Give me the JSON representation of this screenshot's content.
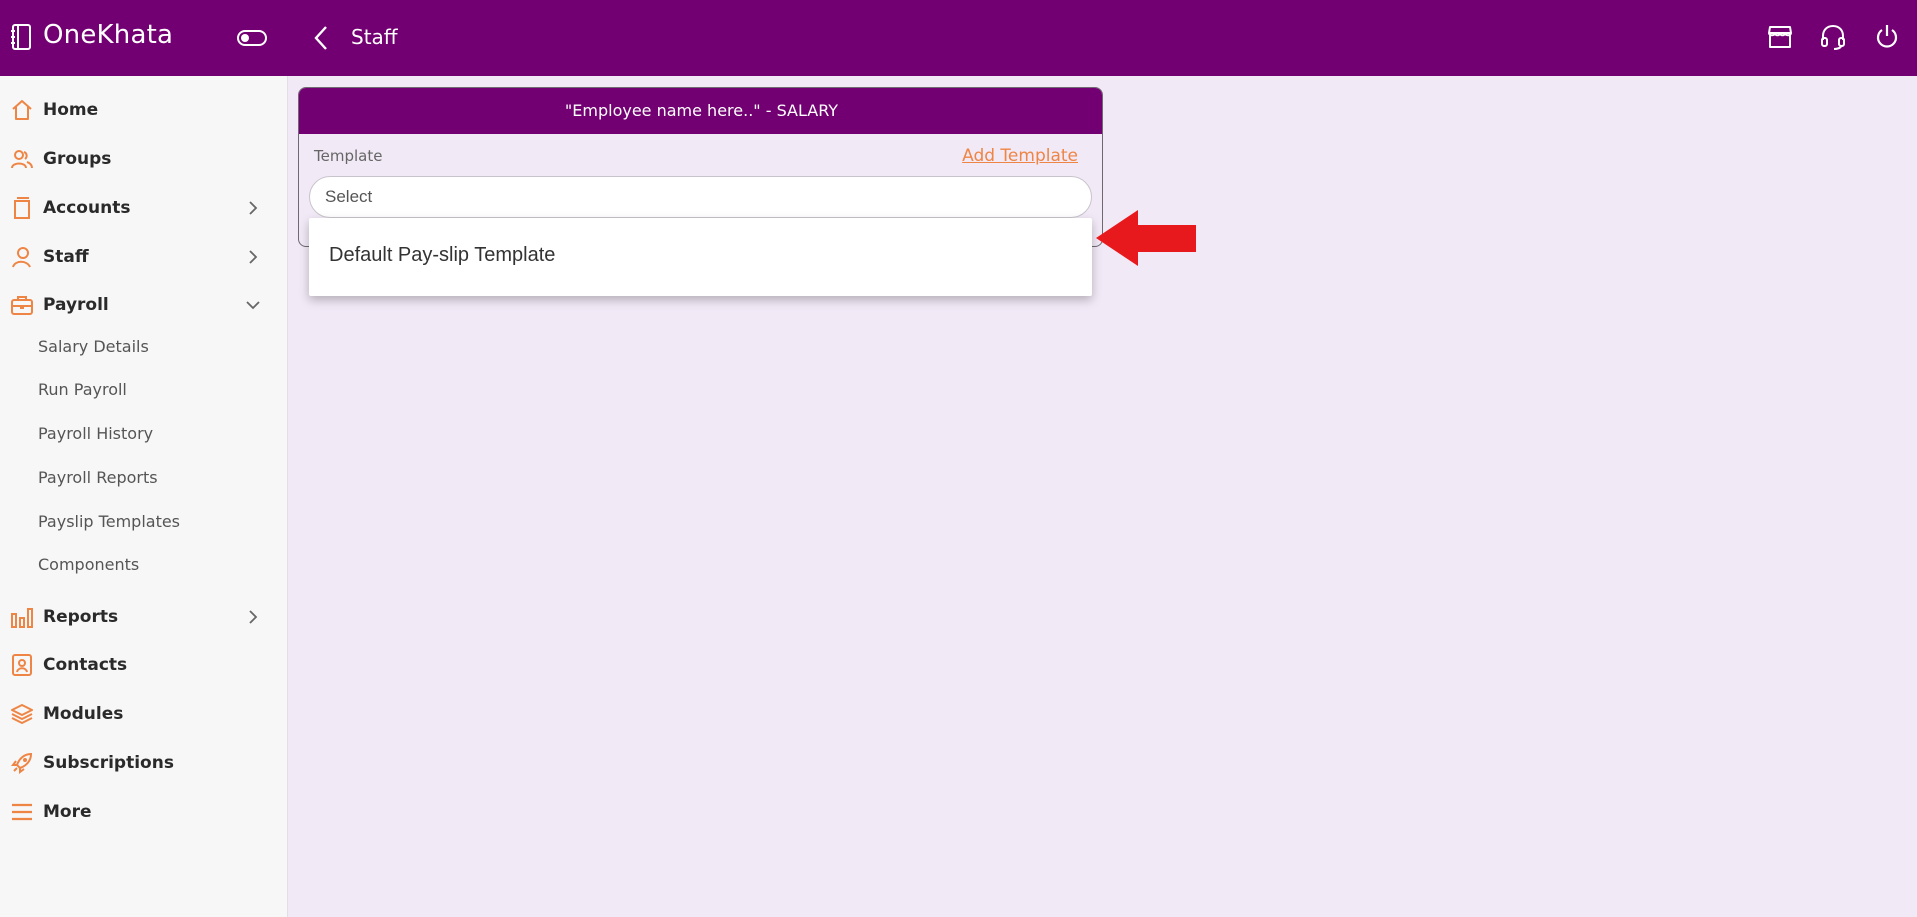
{
  "app": {
    "name": "OneKhata"
  },
  "topbar": {
    "title": "Staff"
  },
  "sidebar": {
    "items": [
      {
        "label": "Home",
        "icon": "home-icon"
      },
      {
        "label": "Groups",
        "icon": "groups-icon"
      },
      {
        "label": "Accounts",
        "icon": "accounts-icon",
        "chevron": "right"
      },
      {
        "label": "Staff",
        "icon": "staff-icon",
        "chevron": "right"
      },
      {
        "label": "Payroll",
        "icon": "briefcase-icon",
        "chevron": "down"
      },
      {
        "label": "Reports",
        "icon": "bar-chart-icon",
        "chevron": "right"
      },
      {
        "label": "Contacts",
        "icon": "contact-card-icon"
      },
      {
        "label": "Modules",
        "icon": "layers-icon"
      },
      {
        "label": "Subscriptions",
        "icon": "rocket-icon"
      },
      {
        "label": "More",
        "icon": "menu-icon"
      }
    ],
    "payroll_sub": [
      "Salary Details",
      "Run Payroll",
      "Payroll History",
      "Payroll Reports",
      "Payslip Templates",
      "Components"
    ]
  },
  "card": {
    "header": "\"Employee name here..\" - SALARY",
    "template_label": "Template",
    "add_template": "Add Template",
    "select_placeholder": "Select"
  },
  "dropdown": {
    "options": [
      "Default Pay-slip Template"
    ]
  },
  "colors": {
    "brand": "#730072",
    "accent": "#ee8544",
    "background": "#f1e9f6",
    "annotation_arrow": "#e8191c"
  }
}
